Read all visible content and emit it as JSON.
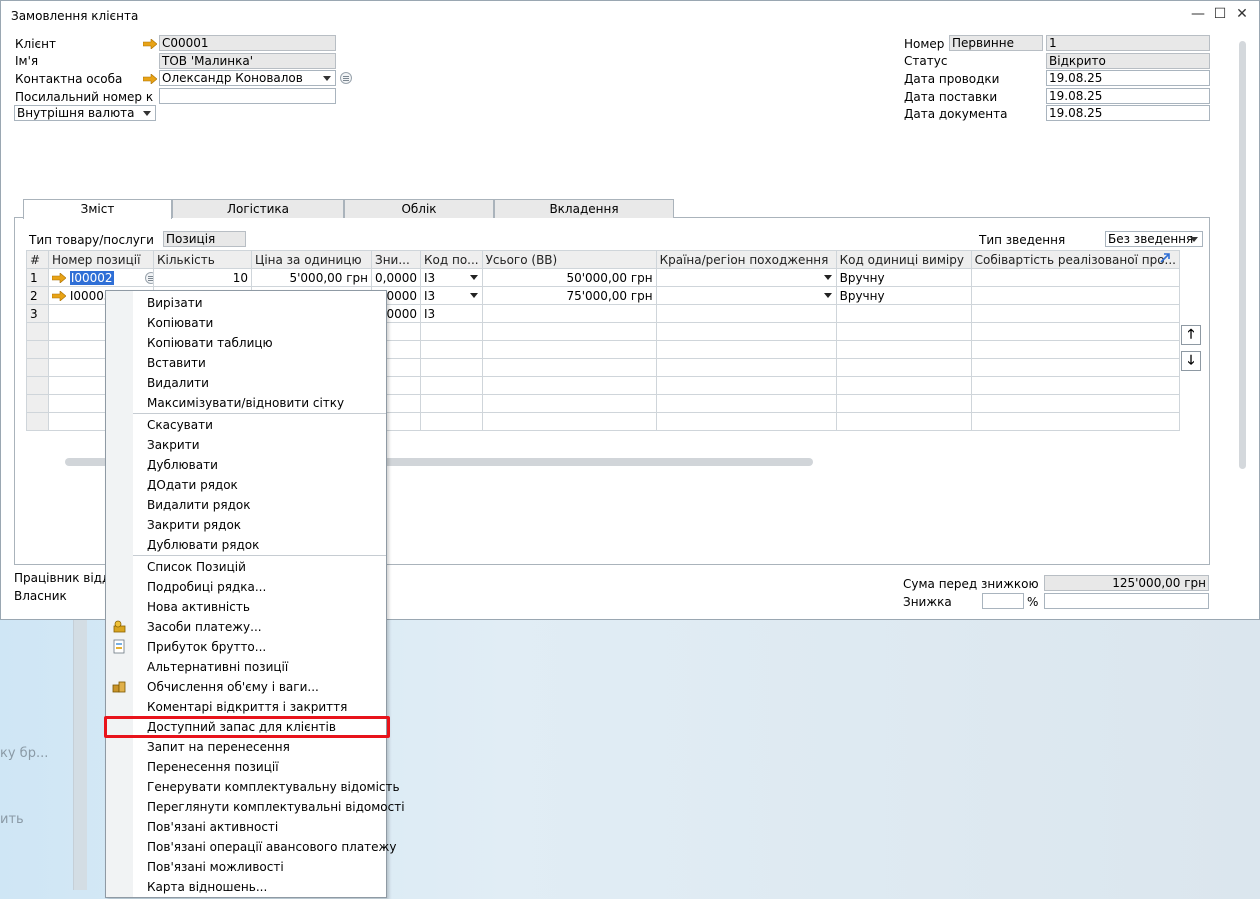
{
  "window": {
    "title": "Замовлення клієнта",
    "minimize": "—",
    "maximize": "☐",
    "close": "✕"
  },
  "header_left": {
    "client_label": "Клієнт",
    "client_value": "C00001",
    "name_label": "Ім'я",
    "name_value": "ТОВ 'Малинка'",
    "contact_label": "Контактна особа",
    "contact_value": "Олександр Коновалов",
    "ref_label": "Посилальний номер к",
    "ref_value": "",
    "currency_value": "Внутрішня валюта"
  },
  "header_right": {
    "number_label": "Номер",
    "number_series": "Первинне",
    "number_value": "1",
    "status_label": "Статус",
    "status_value": "Відкрито",
    "posting_date_label": "Дата проводки",
    "posting_date_value": "19.08.25",
    "delivery_date_label": "Дата поставки",
    "delivery_date_value": "19.08.25",
    "document_date_label": "Дата документа",
    "document_date_value": "19.08.25"
  },
  "tabs": [
    {
      "label": "Зміст"
    },
    {
      "label": "Логістика"
    },
    {
      "label": "Облік"
    },
    {
      "label": "Вкладення"
    }
  ],
  "content": {
    "item_type_label": "Тип товару/послуги",
    "item_type_value": "Позиція",
    "summary_type_label": "Тип зведення",
    "summary_type_value": "Без зведення"
  },
  "grid": {
    "columns": [
      "#",
      "Номер позиції",
      "Кількість",
      "Ціна за одиницю",
      "Зни...",
      "Код по...",
      "Усього (ВВ)",
      "Країна/регіон походження",
      "Код одиниці виміру",
      "Собівартість реалізованої про..."
    ],
    "rows": [
      {
        "n": "1",
        "item": "I00002",
        "qty": "10",
        "price": "5'000,00 грн",
        "disc": "0,0000",
        "tax": "I3",
        "total": "50'000,00 грн",
        "country": "",
        "uom": "Вручну",
        "cogs": ""
      },
      {
        "n": "2",
        "item": "I00003",
        "qty": "",
        "price": "",
        "disc": "0,0000",
        "tax": "I3",
        "total": "75'000,00 грн",
        "country": "",
        "uom": "Вручну",
        "cogs": ""
      },
      {
        "n": "3",
        "item": "",
        "qty": "",
        "price": "",
        "disc": "0,0000",
        "tax": "I3",
        "total": "",
        "country": "",
        "uom": "",
        "cogs": ""
      }
    ]
  },
  "footer": {
    "employee_label": "Працівник відділ",
    "owner_label": "Власник",
    "total_before_discount_label": "Сума перед знижкою",
    "total_before_discount_value": "125'000,00 грн",
    "discount_label": "Знижка",
    "discount_pct_sign": "%"
  },
  "context_menu": {
    "items": [
      {
        "label": "Вирізати"
      },
      {
        "label": "Копіювати"
      },
      {
        "label": "Копіювати таблицю"
      },
      {
        "label": "Вставити"
      },
      {
        "label": "Видалити"
      },
      {
        "label": "Максимізувати/відновити сітку"
      },
      {
        "label": "Скасувати"
      },
      {
        "label": "Закрити"
      },
      {
        "label": "Дублювати"
      },
      {
        "label": "ДОдати рядок"
      },
      {
        "label": "Видалити рядок"
      },
      {
        "label": "Закрити рядок"
      },
      {
        "label": "Дублювати рядок"
      },
      {
        "label": "Список Позицій"
      },
      {
        "label": "Подробиці рядка..."
      },
      {
        "label": "Нова активність"
      },
      {
        "label": "Засоби платежу...",
        "icon": "payment-icon"
      },
      {
        "label": "Прибуток брутто...",
        "icon": "gross-profit-icon"
      },
      {
        "label": "Альтернативні позиції"
      },
      {
        "label": "Обчислення об'єму і ваги...",
        "icon": "volume-weight-icon"
      },
      {
        "label": "Коментарі відкриття і закриття"
      },
      {
        "label": "Доступний запас для клієнтів"
      },
      {
        "label": "Запит на перенесення"
      },
      {
        "label": "Перенесення позиції"
      },
      {
        "label": "Генерувати комплектувальну відомість"
      },
      {
        "label": "Переглянути комплектувальні відомості"
      },
      {
        "label": "Пов'язані активності"
      },
      {
        "label": "Пов'язані операції авансового платежу"
      },
      {
        "label": "Пов'язані можливості"
      },
      {
        "label": "Карта відношень..."
      }
    ]
  },
  "desktop": {
    "ghost_text_1": "ку бр...",
    "ghost_text_2": "ить"
  },
  "colors": {
    "accent": "#2f6fd6",
    "highlight_box": "#e8131b",
    "link_arrow": "#e8a317"
  }
}
